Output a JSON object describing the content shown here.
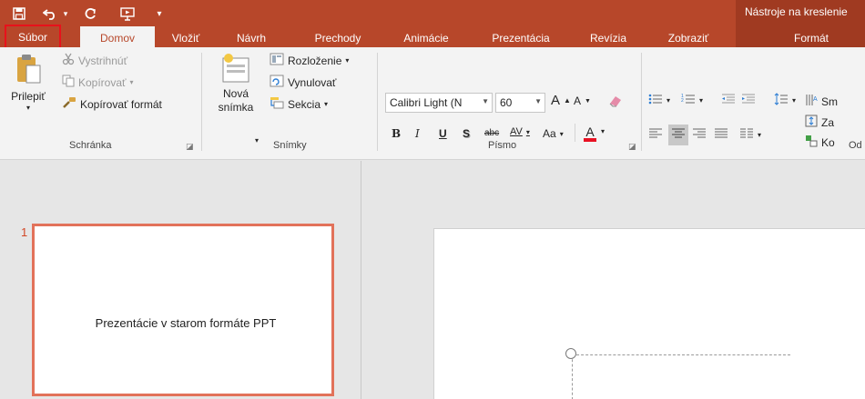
{
  "qat": {
    "save_icon": "save-icon",
    "undo_icon": "undo-icon",
    "redo_icon": "redo-icon",
    "slideshow_icon": "start-from-beginning-icon",
    "customize_icon": "customize-qat-icon"
  },
  "contextual": {
    "label": "Nástroje na kreslenie"
  },
  "tabs": {
    "file": "Súbor",
    "home": "Domov",
    "insert": "Vložiť",
    "design": "Návrh",
    "transitions": "Prechody",
    "animations": "Animácie",
    "slideshow": "Prezentácia",
    "review": "Revízia",
    "view": "Zobraziť",
    "format": "Formát"
  },
  "clipboard": {
    "paste": "Prilepiť",
    "cut": "Vystrihnúť",
    "copy": "Kopírovať",
    "format_painter": "Kopírovať formát",
    "group": "Schránka"
  },
  "slides": {
    "new_slide_line1": "Nová",
    "new_slide_line2": "snímka",
    "layout": "Rozloženie",
    "reset": "Vynulovať",
    "section": "Sekcia",
    "group": "Snímky"
  },
  "font": {
    "name": "Calibri Light (N",
    "size": "60",
    "bold": "B",
    "italic": "I",
    "underline": "U",
    "shadow": "S",
    "strike": "abc",
    "spacing": "AV",
    "case": "Aa",
    "color": "A",
    "grow": "A",
    "shrink": "A",
    "group": "Písmo"
  },
  "paragraph": {
    "text_direction_prefix": "Sm",
    "align_text_prefix": "Za",
    "convert_prefix": "Ko",
    "group_prefix": "Od"
  },
  "colors": {
    "accent": "#b7472a",
    "file_highlight": "#e8111b",
    "thumb_border": "#e2725a",
    "font_color": "#e81123"
  },
  "thumbnail": {
    "number": "1",
    "title": "Prezentácie v starom formáte PPT"
  }
}
